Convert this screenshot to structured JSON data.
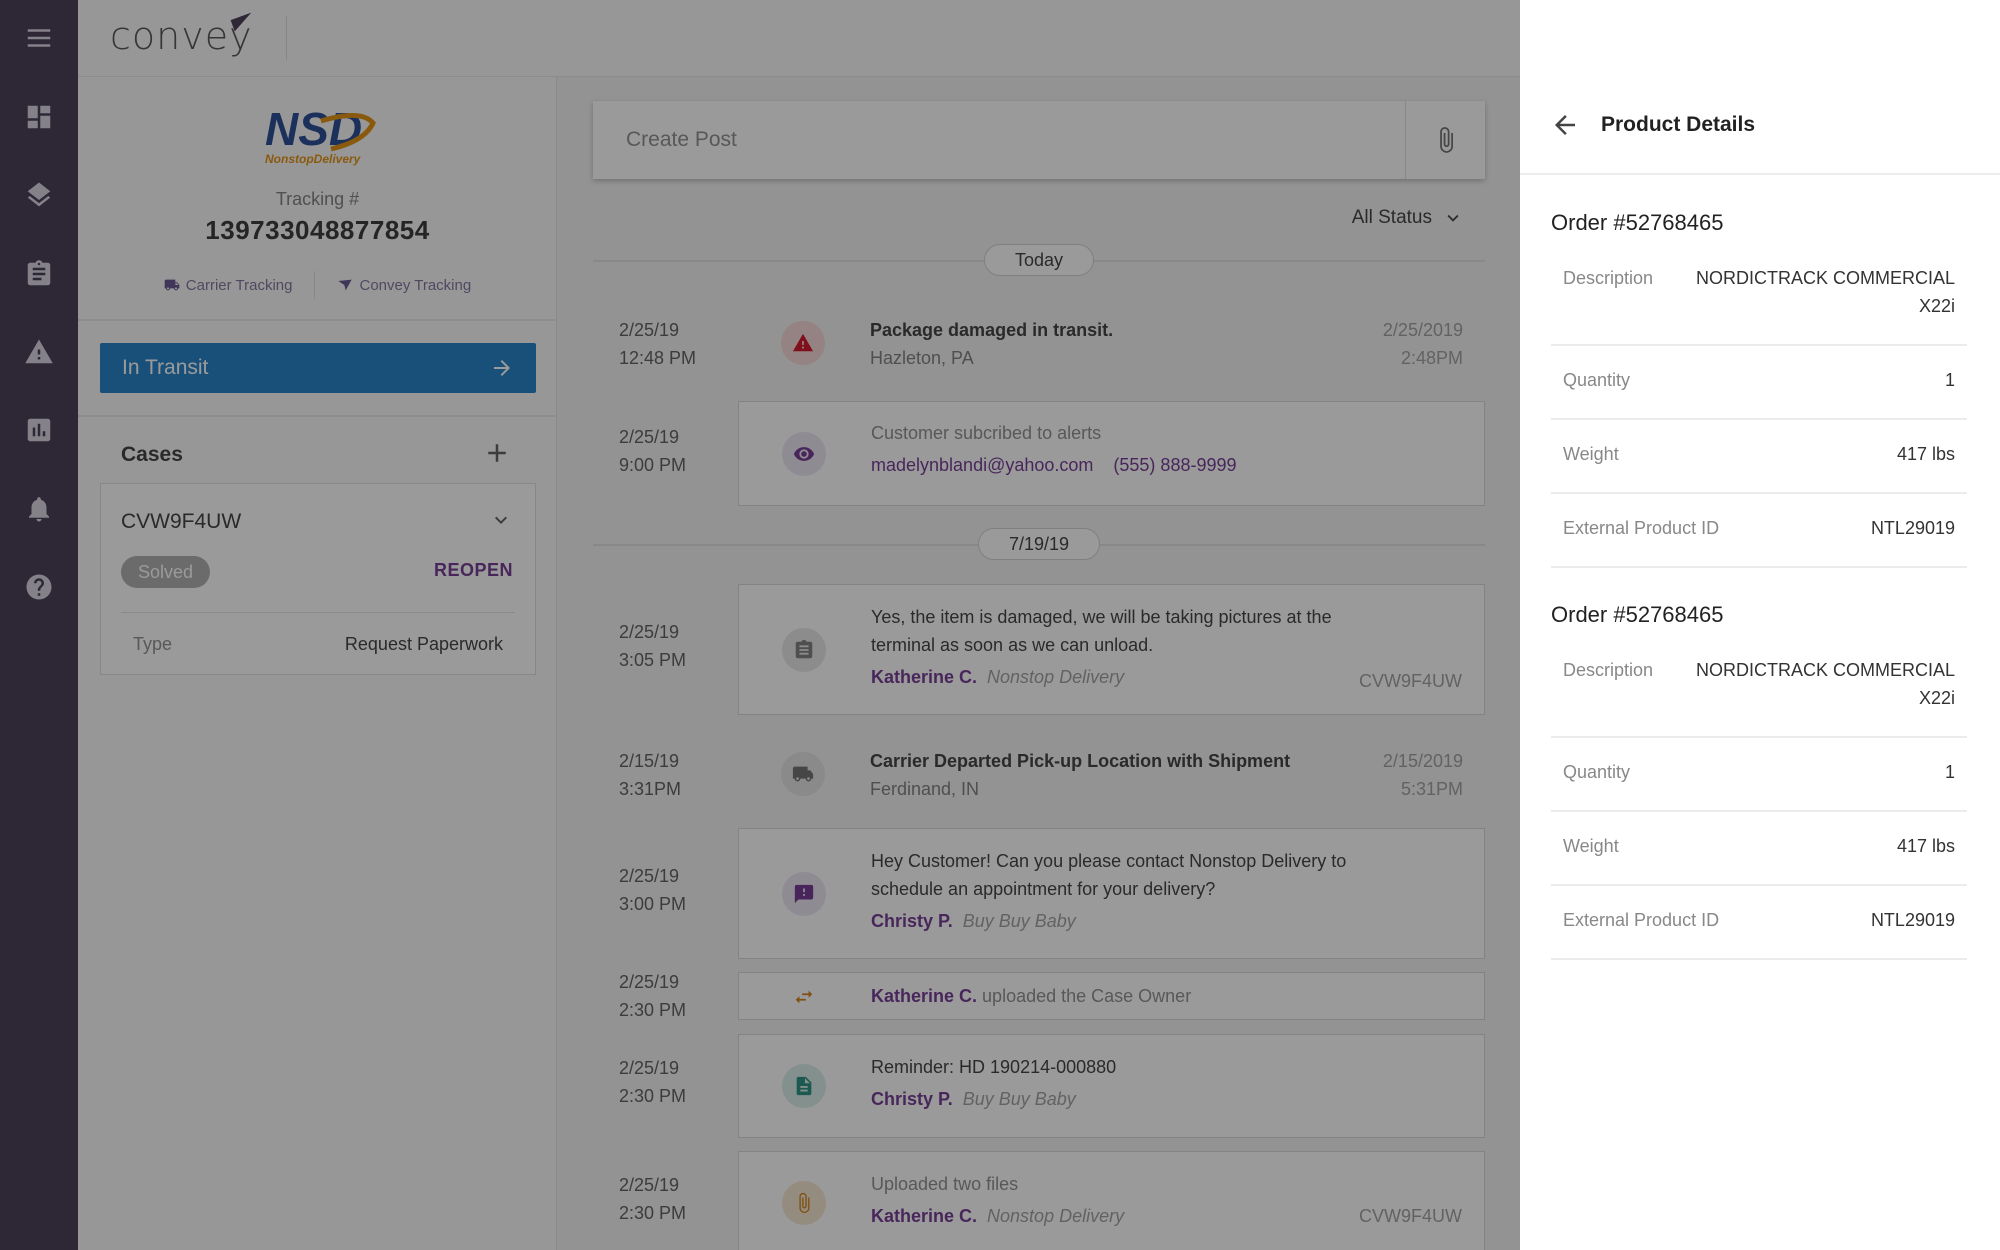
{
  "app": {
    "logo_text": "convey"
  },
  "rail": {
    "items": [
      {
        "name": "menu-icon"
      },
      {
        "name": "dashboard-icon"
      },
      {
        "name": "layers-icon"
      },
      {
        "name": "clipboard-icon"
      },
      {
        "name": "warning-icon"
      },
      {
        "name": "analytics-icon"
      },
      {
        "name": "bell-icon"
      },
      {
        "name": "help-icon"
      }
    ]
  },
  "shipment": {
    "carrier_logo_text": "NSD",
    "carrier_logo_sub": "NonstopDelivery",
    "tracking_label": "Tracking #",
    "tracking_number": "139733048877854",
    "carrier_tracking": "Carrier Tracking",
    "convey_tracking": "Convey Tracking",
    "status": "In Transit"
  },
  "cases": {
    "title": "Cases",
    "case_id": "CVW9F4UW",
    "badge": "Solved",
    "reopen": "REOPEN",
    "type_label": "Type",
    "type_value": "Request Paperwork"
  },
  "feed": {
    "create_post_placeholder": "Create Post",
    "filter": "All Status",
    "date_today": "Today",
    "date_second": "7/19/19",
    "items": [
      {
        "date": "2/25/19",
        "time": "12:48 PM",
        "title": "Package damaged in transit.",
        "sub": "Hazleton, PA",
        "right_date": "2/25/2019",
        "right_time": "2:48PM"
      },
      {
        "date": "2/25/19",
        "time": "9:00 PM",
        "title": "Customer subcribed to alerts",
        "email": "madelynblandi@yahoo.com",
        "phone": "(555) 888-9999"
      },
      {
        "date": "2/25/19",
        "time": "3:05 PM",
        "line1": "Yes, the item is damaged, we will be taking pictures at the",
        "line2": "terminal as soon as we can unload.",
        "author": "Katherine C.",
        "org": "Nonstop Delivery",
        "case": "CVW9F4UW"
      },
      {
        "date": "2/15/19",
        "time": "3:31PM",
        "title": "Carrier Departed Pick-up Location with Shipment",
        "sub": "Ferdinand, IN",
        "right_date": "2/15/2019",
        "right_time": "5:31PM"
      },
      {
        "date": "2/25/19",
        "time": "3:00 PM",
        "line1": "Hey Customer! Can you please contact Nonstop Delivery to",
        "line2": "schedule an appointment for your delivery?",
        "author": "Christy P.",
        "org": "Buy Buy Baby"
      },
      {
        "date": "2/25/19",
        "time": "2:30 PM",
        "author": "Katherine C.",
        "action": "uploaded the Case Owner"
      },
      {
        "date": "2/25/19",
        "time": "2:30 PM",
        "line1": "Reminder: HD 190214-000880",
        "author": "Christy P.",
        "org": "Buy Buy Baby"
      },
      {
        "date": "2/25/19",
        "time": "2:30 PM",
        "line1": "Uploaded two files",
        "author": "Katherine C.",
        "org": "Nonstop Delivery",
        "case": "CVW9F4UW"
      }
    ]
  },
  "product_panel": {
    "title": "Product Details",
    "orders": [
      {
        "title": "Order #52768465",
        "desc_label": "Description",
        "desc_line1": "NORDICTRACK COMMERCIAL",
        "desc_line2": "X22i",
        "qty_label": "Quantity",
        "qty": "1",
        "weight_label": "Weight",
        "weight": "417 lbs",
        "ext_label": "External Product ID",
        "ext": "NTL29019"
      },
      {
        "title": "Order #52768465",
        "desc_label": "Description",
        "desc_line1": "NORDICTRACK COMMERCIAL",
        "desc_line2": "X22i",
        "qty_label": "Quantity",
        "qty": "1",
        "weight_label": "Weight",
        "weight": "417 lbs",
        "ext_label": "External Product ID",
        "ext": "NTL29019"
      }
    ]
  },
  "colors": {
    "rail": "#3a2f4a",
    "status_blue": "#1479c4",
    "accent_purple": "#6b2d8c",
    "danger_red": "#d0021b",
    "overlay": "rgba(30,30,30,0.45)"
  }
}
